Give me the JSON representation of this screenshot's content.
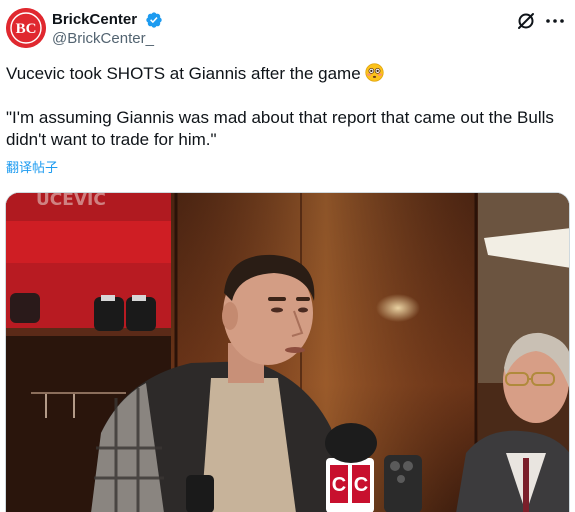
{
  "author": {
    "display_name": "BrickCenter",
    "handle": "@BrickCenter_",
    "verified": true,
    "avatar_text": "BC"
  },
  "tweet": {
    "line1": "Vucevic took SHOTS at Giannis after the game",
    "line2": "\"I'm assuming Giannis was mad about that report that came out the Bulls didn't want to trade for him.\"",
    "translate_label": "翻译帖子"
  },
  "media": {
    "locker_nameplate": "UCEVIC",
    "mic_flag_letters": [
      "C",
      "C"
    ]
  },
  "colors": {
    "accent_blue": "#1d9bf0",
    "verified_blue": "#1d9bf0",
    "avatar_red": "#e0282f",
    "text_primary": "#0f1419",
    "text_secondary": "#536471"
  },
  "icons": {
    "verified": "verified-badge-icon",
    "grok": "grok-icon",
    "more": "more-icon",
    "emoji": "flushed-face-emoji"
  }
}
